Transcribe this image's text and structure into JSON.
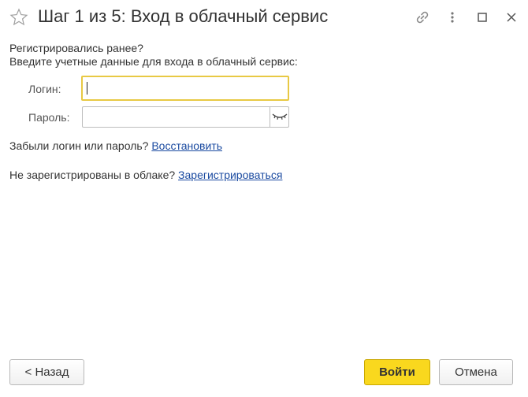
{
  "window": {
    "title": "Шаг 1 из 5: Вход в облачный сервис",
    "icons": [
      "star-icon",
      "link-icon",
      "more-icon",
      "maximize-icon",
      "close-icon"
    ]
  },
  "intro": {
    "line1": "Регистрировались ранее?",
    "line2": "Введите учетные данные для входа в облачный сервис:"
  },
  "form": {
    "login_label": "Логин:",
    "login_value": "",
    "password_label": "Пароль:",
    "password_value": ""
  },
  "forgot": {
    "text": "Забыли логин или пароль? ",
    "link": "Восстановить"
  },
  "register": {
    "text": "Не зарегистрированы в облаке? ",
    "link": "Зарегистрироваться"
  },
  "buttons": {
    "back": "< Назад",
    "login": "Войти",
    "cancel": "Отмена"
  },
  "colors": {
    "accent": "#f9d81e",
    "focus_border": "#e8c944",
    "link": "#1a4aa0"
  }
}
